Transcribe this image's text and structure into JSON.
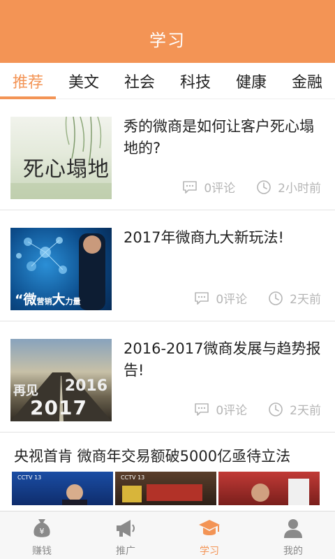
{
  "header": {
    "title": "学习"
  },
  "tabs": [
    {
      "label": "推荐",
      "active": true
    },
    {
      "label": "美文",
      "active": false
    },
    {
      "label": "社会",
      "active": false
    },
    {
      "label": "科技",
      "active": false
    },
    {
      "label": "健康",
      "active": false
    },
    {
      "label": "金融",
      "active": false
    }
  ],
  "articles": [
    {
      "title": "秀的微商是如何让客户死心塌地的?",
      "image_text": "死心塌地",
      "comments": "0评论",
      "time": "2小时前"
    },
    {
      "title": "2017年微商九大新玩法!",
      "image_text_a": "“微",
      "image_text_b": "营销",
      "image_text_c": "大",
      "image_text_d": "力量",
      "comments": "0评论",
      "time": "2天前"
    },
    {
      "title": "2016-2017微商发展与趋势报告!",
      "image_text_a": "再见",
      "image_text_b": "2016",
      "image_text_c": "2017",
      "comments": "0评论",
      "time": "2天前"
    }
  ],
  "feature": {
    "title": "央视首肯 微商年交易额破5000亿亟待立法",
    "video_logo": "CCTV 13"
  },
  "bottom_nav": [
    {
      "label": "赚钱",
      "icon": "money-bag-icon",
      "active": false
    },
    {
      "label": "推广",
      "icon": "megaphone-icon",
      "active": false
    },
    {
      "label": "学习",
      "icon": "graduation-cap-icon",
      "active": true
    },
    {
      "label": "我的",
      "icon": "person-icon",
      "active": false
    }
  ],
  "colors": {
    "accent": "#f39455",
    "meta_gray": "#b5b5b5"
  }
}
